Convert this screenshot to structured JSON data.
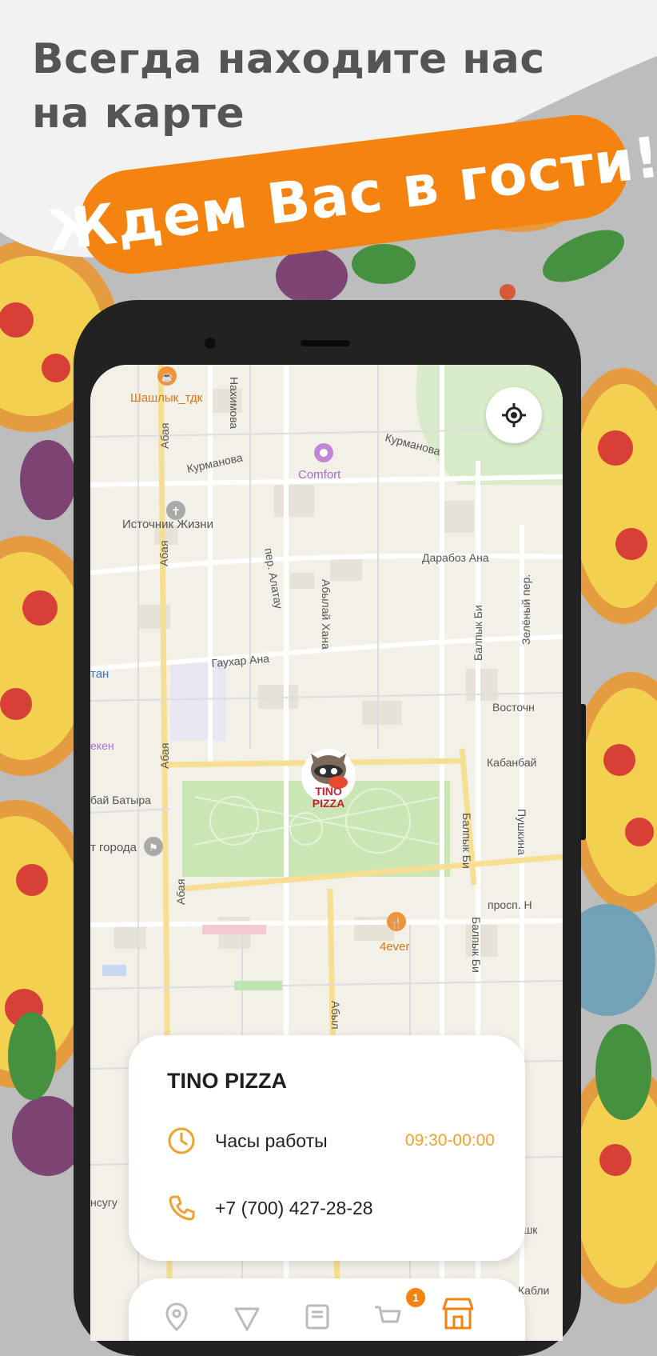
{
  "promo": {
    "headline_line1": "Всегда находите нас",
    "headline_line2": "на карте",
    "banner": "Ждем Вас в гости!"
  },
  "map": {
    "pois": {
      "shashlyk": "Шашлык_тдк",
      "comfort": "Comfort",
      "istochnik": "Источник Жизни",
      "fourever": "4ever",
      "edge_gorod": "т города",
      "edge_tan": "тан",
      "edge_eken": "екен"
    },
    "streets": {
      "nakhimova": "Нахимова",
      "abaya_1": "Абая",
      "abaya_2": "Абая",
      "abaya_3": "Абая",
      "abaya_4": "Абая",
      "kurmanova_1": "Курманова",
      "kurmanova_2": "Курманова",
      "darabaz": "Дарабоз Ана",
      "alatau": "пер. Алатау",
      "abylai": "Абылай Хана",
      "abylai_2": "Абыл",
      "balpyk_1": "Балпык Би",
      "balpyk_2": "Балпык Би",
      "balpyk_3": "Балпык Би",
      "zeleny": "Зелёный пер.",
      "gaukhar": "Гаухар Ана",
      "vostochn": "Восточн",
      "kabanbai": "Кабанбай",
      "bai_batyra": "бай Батыра",
      "pushkina": "Пушкина",
      "prosp": "просп. Н",
      "nsugu": "нсугу",
      "push": "Пушк",
      "kabli": "Кабли"
    },
    "marker_label_1": "TINO",
    "marker_label_2": "PIZZA"
  },
  "card": {
    "title": "TINO PIZZA",
    "hours_label": "Часы работы",
    "hours_value": "09:30-00:00",
    "phone": "+7 (700) 427-28-28"
  },
  "nav": {
    "badge_count": "1"
  },
  "colors": {
    "accent": "#f4830f",
    "hours": "#f0a22e",
    "headline": "#555555"
  }
}
